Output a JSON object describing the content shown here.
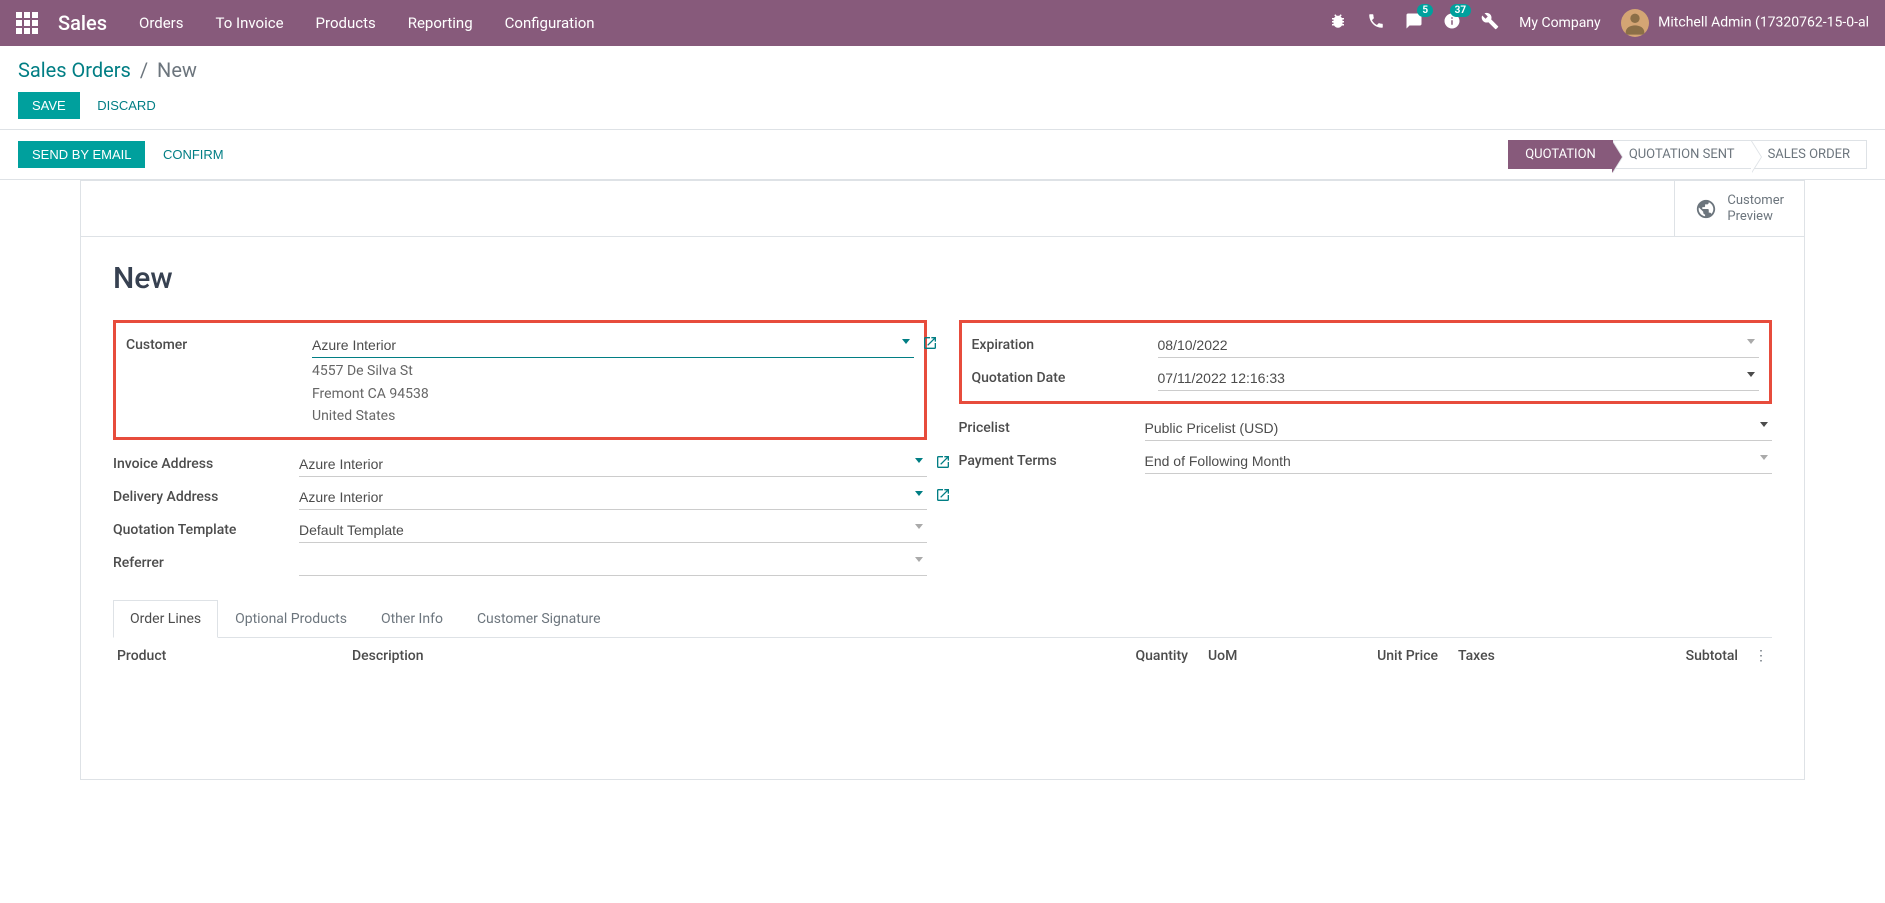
{
  "nav": {
    "brand": "Sales",
    "items": [
      "Orders",
      "To Invoice",
      "Products",
      "Reporting",
      "Configuration"
    ],
    "chat_badge": "5",
    "activity_badge": "37",
    "company": "My Company",
    "user": "Mitchell Admin (17320762-15-0-al"
  },
  "breadcrumb": {
    "parent": "Sales Orders",
    "current": "New"
  },
  "buttons": {
    "save": "SAVE",
    "discard": "DISCARD",
    "send_email": "SEND BY EMAIL",
    "confirm": "CONFIRM"
  },
  "status": {
    "quotation": "QUOTATION",
    "sent": "QUOTATION SENT",
    "order": "SALES ORDER"
  },
  "stat": {
    "line1": "Customer",
    "line2": "Preview"
  },
  "record": {
    "title": "New",
    "labels": {
      "customer": "Customer",
      "invoice_addr": "Invoice Address",
      "delivery_addr": "Delivery Address",
      "quote_tmpl": "Quotation Template",
      "referrer": "Referrer",
      "expiration": "Expiration",
      "quote_date": "Quotation Date",
      "pricelist": "Pricelist",
      "payment_terms": "Payment Terms"
    },
    "values": {
      "customer": "Azure Interior",
      "addr_line1": "4557 De Silva St",
      "addr_line2": "Fremont CA 94538",
      "addr_line3": "United States",
      "invoice_addr": "Azure Interior",
      "delivery_addr": "Azure Interior",
      "quote_tmpl": "Default Template",
      "referrer": "",
      "expiration": "08/10/2022",
      "quote_date": "07/11/2022 12:16:33",
      "pricelist": "Public Pricelist (USD)",
      "payment_terms": "End of Following Month"
    }
  },
  "tabs": {
    "order_lines": "Order Lines",
    "optional": "Optional Products",
    "other": "Other Info",
    "signature": "Customer Signature"
  },
  "columns": {
    "product": "Product",
    "description": "Description",
    "quantity": "Quantity",
    "uom": "UoM",
    "unit_price": "Unit Price",
    "taxes": "Taxes",
    "subtotal": "Subtotal"
  }
}
